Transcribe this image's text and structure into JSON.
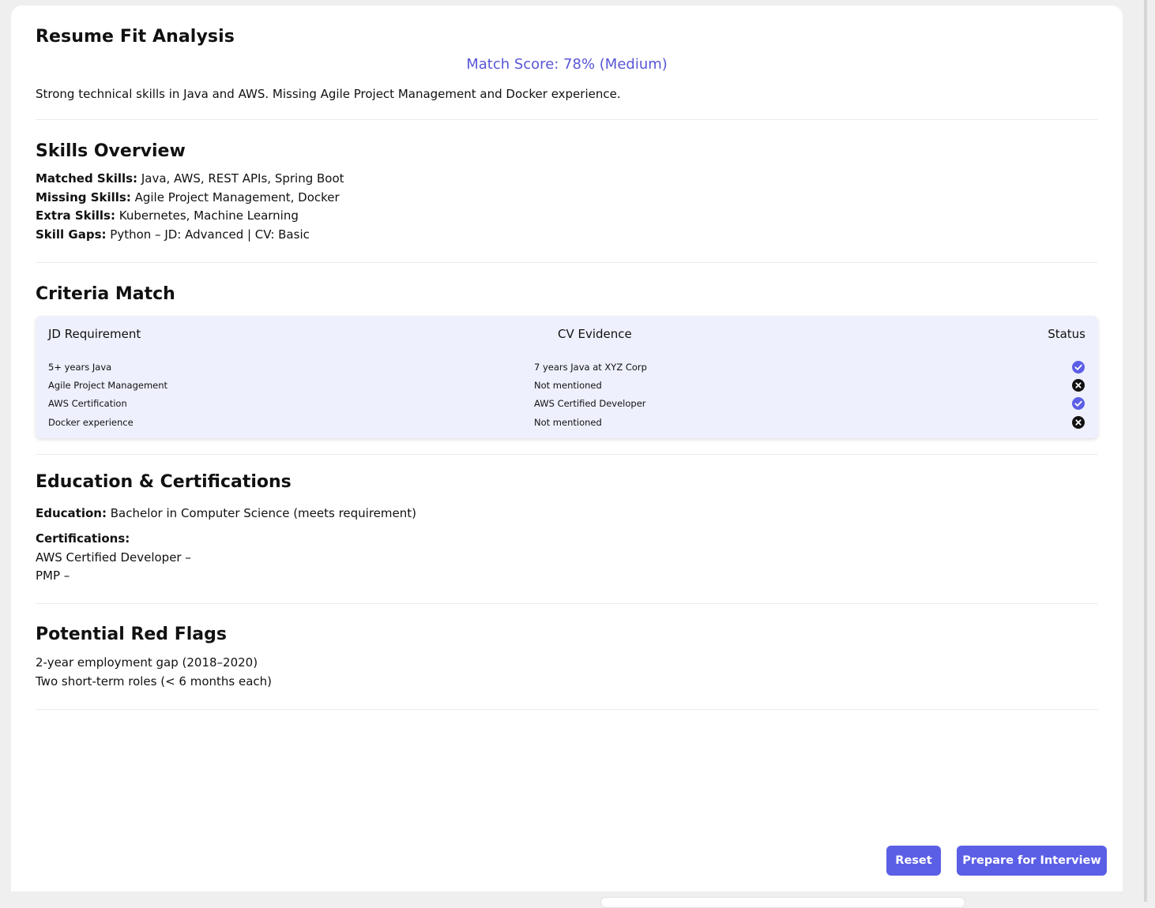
{
  "header": {
    "title": "Resume Fit Analysis",
    "match_score": "Match Score: 78% (Medium)",
    "summary": "Strong technical skills in Java and AWS. Missing Agile Project Management and Docker experience."
  },
  "skills": {
    "heading": "Skills Overview",
    "matched_label": "Matched Skills:",
    "matched_value": " Java, AWS, REST APIs, Spring Boot",
    "missing_label": "Missing Skills:",
    "missing_value": " Agile Project Management, Docker",
    "extra_label": "Extra Skills:",
    "extra_value": " Kubernetes, Machine Learning",
    "gaps_label": "Skill Gaps:",
    "gaps_value": " Python – JD: Advanced | CV: Basic"
  },
  "criteria": {
    "heading": "Criteria Match",
    "columns": [
      "JD Requirement",
      "CV Evidence",
      "Status"
    ],
    "rows": [
      {
        "requirement": "5+ years Java",
        "evidence": "7 years Java at XYZ Corp",
        "status": "check-icon"
      },
      {
        "requirement": "Agile Project Management",
        "evidence": "Not mentioned",
        "status": "x-icon"
      },
      {
        "requirement": "AWS Certification",
        "evidence": "AWS Certified Developer",
        "status": "check-icon"
      },
      {
        "requirement": "Docker experience",
        "evidence": "Not mentioned",
        "status": "x-icon"
      }
    ]
  },
  "education": {
    "heading": "Education & Certifications",
    "education_label": "Education:",
    "education_value": " Bachelor in Computer Science (meets requirement)",
    "certifications_label": "Certifications:",
    "certifications": [
      "AWS Certified Developer –",
      "PMP –"
    ]
  },
  "red_flags": {
    "heading": "Potential Red Flags",
    "items": [
      "2-year employment gap (2018–2020)",
      "Two short-term roles (< 6 months each)"
    ]
  },
  "actions": {
    "reset_label": "Reset",
    "prepare_label": "Prepare for Interview"
  },
  "colors": {
    "accent": "#5856d6",
    "button": "#5b5fe5",
    "check": "#5b5fe5",
    "x": "#111111",
    "table_bg": "#eef0fd"
  }
}
